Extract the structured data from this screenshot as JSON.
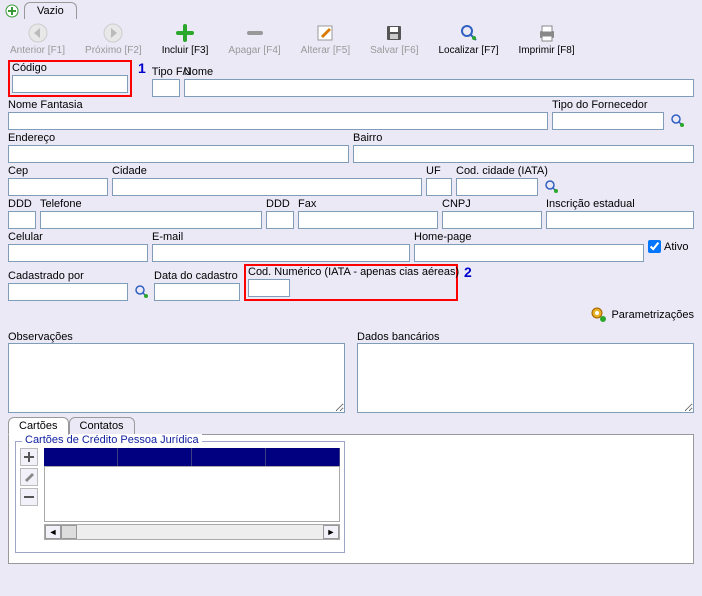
{
  "tabs": {
    "plus_icon": "+",
    "main": "Vazio"
  },
  "toolbar": {
    "anterior": "Anterior [F1]",
    "proximo": "Próximo [F2]",
    "incluir": "Incluir [F3]",
    "apagar": "Apagar [F4]",
    "alterar": "Alterar [F5]",
    "salvar": "Salvar [F6]",
    "localizar": "Localizar [F7]",
    "imprimir": "Imprimir [F8]"
  },
  "callouts": {
    "one": "1",
    "two": "2"
  },
  "labels": {
    "codigo": "Código",
    "tipofj": "Tipo F/J",
    "nome": "Nome",
    "nome_fantasia": "Nome Fantasia",
    "tipo_fornecedor": "Tipo do Fornecedor",
    "endereco": "Endereço",
    "bairro": "Bairro",
    "cep": "Cep",
    "cidade": "Cidade",
    "uf": "UF",
    "cod_cidade_iata": "Cod. cidade (IATA)",
    "ddd": "DDD",
    "telefone": "Telefone",
    "ddd2": "DDD",
    "fax": "Fax",
    "cnpj": "CNPJ",
    "insc_estadual": "Inscrição estadual",
    "celular": "Celular",
    "email": "E-mail",
    "homepage": "Home-page",
    "ativo": "Ativo",
    "cadastrado_por": "Cadastrado por",
    "data_cadastro": "Data do cadastro",
    "cod_numerico_iata": "Cod. Numérico (IATA - apenas cias aéreas)",
    "parametrizacoes": "Parametrizações",
    "observacoes": "Observações",
    "dados_bancarios": "Dados bancários"
  },
  "values": {
    "codigo": "",
    "tipofj": "",
    "nome": "",
    "nome_fantasia": "",
    "tipo_fornecedor": "",
    "endereco": "",
    "bairro": "",
    "cep": "",
    "cidade": "",
    "uf": "",
    "cod_cidade_iata": "",
    "ddd": "",
    "telefone": "",
    "ddd2": "",
    "fax": "",
    "cnpj": "",
    "insc_estadual": "",
    "celular": "",
    "email": "",
    "homepage": "",
    "cadastrado_por": "",
    "data_cadastro": "",
    "cod_numerico_iata": "",
    "observacoes": "",
    "dados_bancarios": ""
  },
  "subtabs": {
    "cartoes": "Cartões",
    "contatos": "Contatos"
  },
  "groupbox": {
    "legend": "Cartões de Crédito Pessoa Jurídica"
  }
}
